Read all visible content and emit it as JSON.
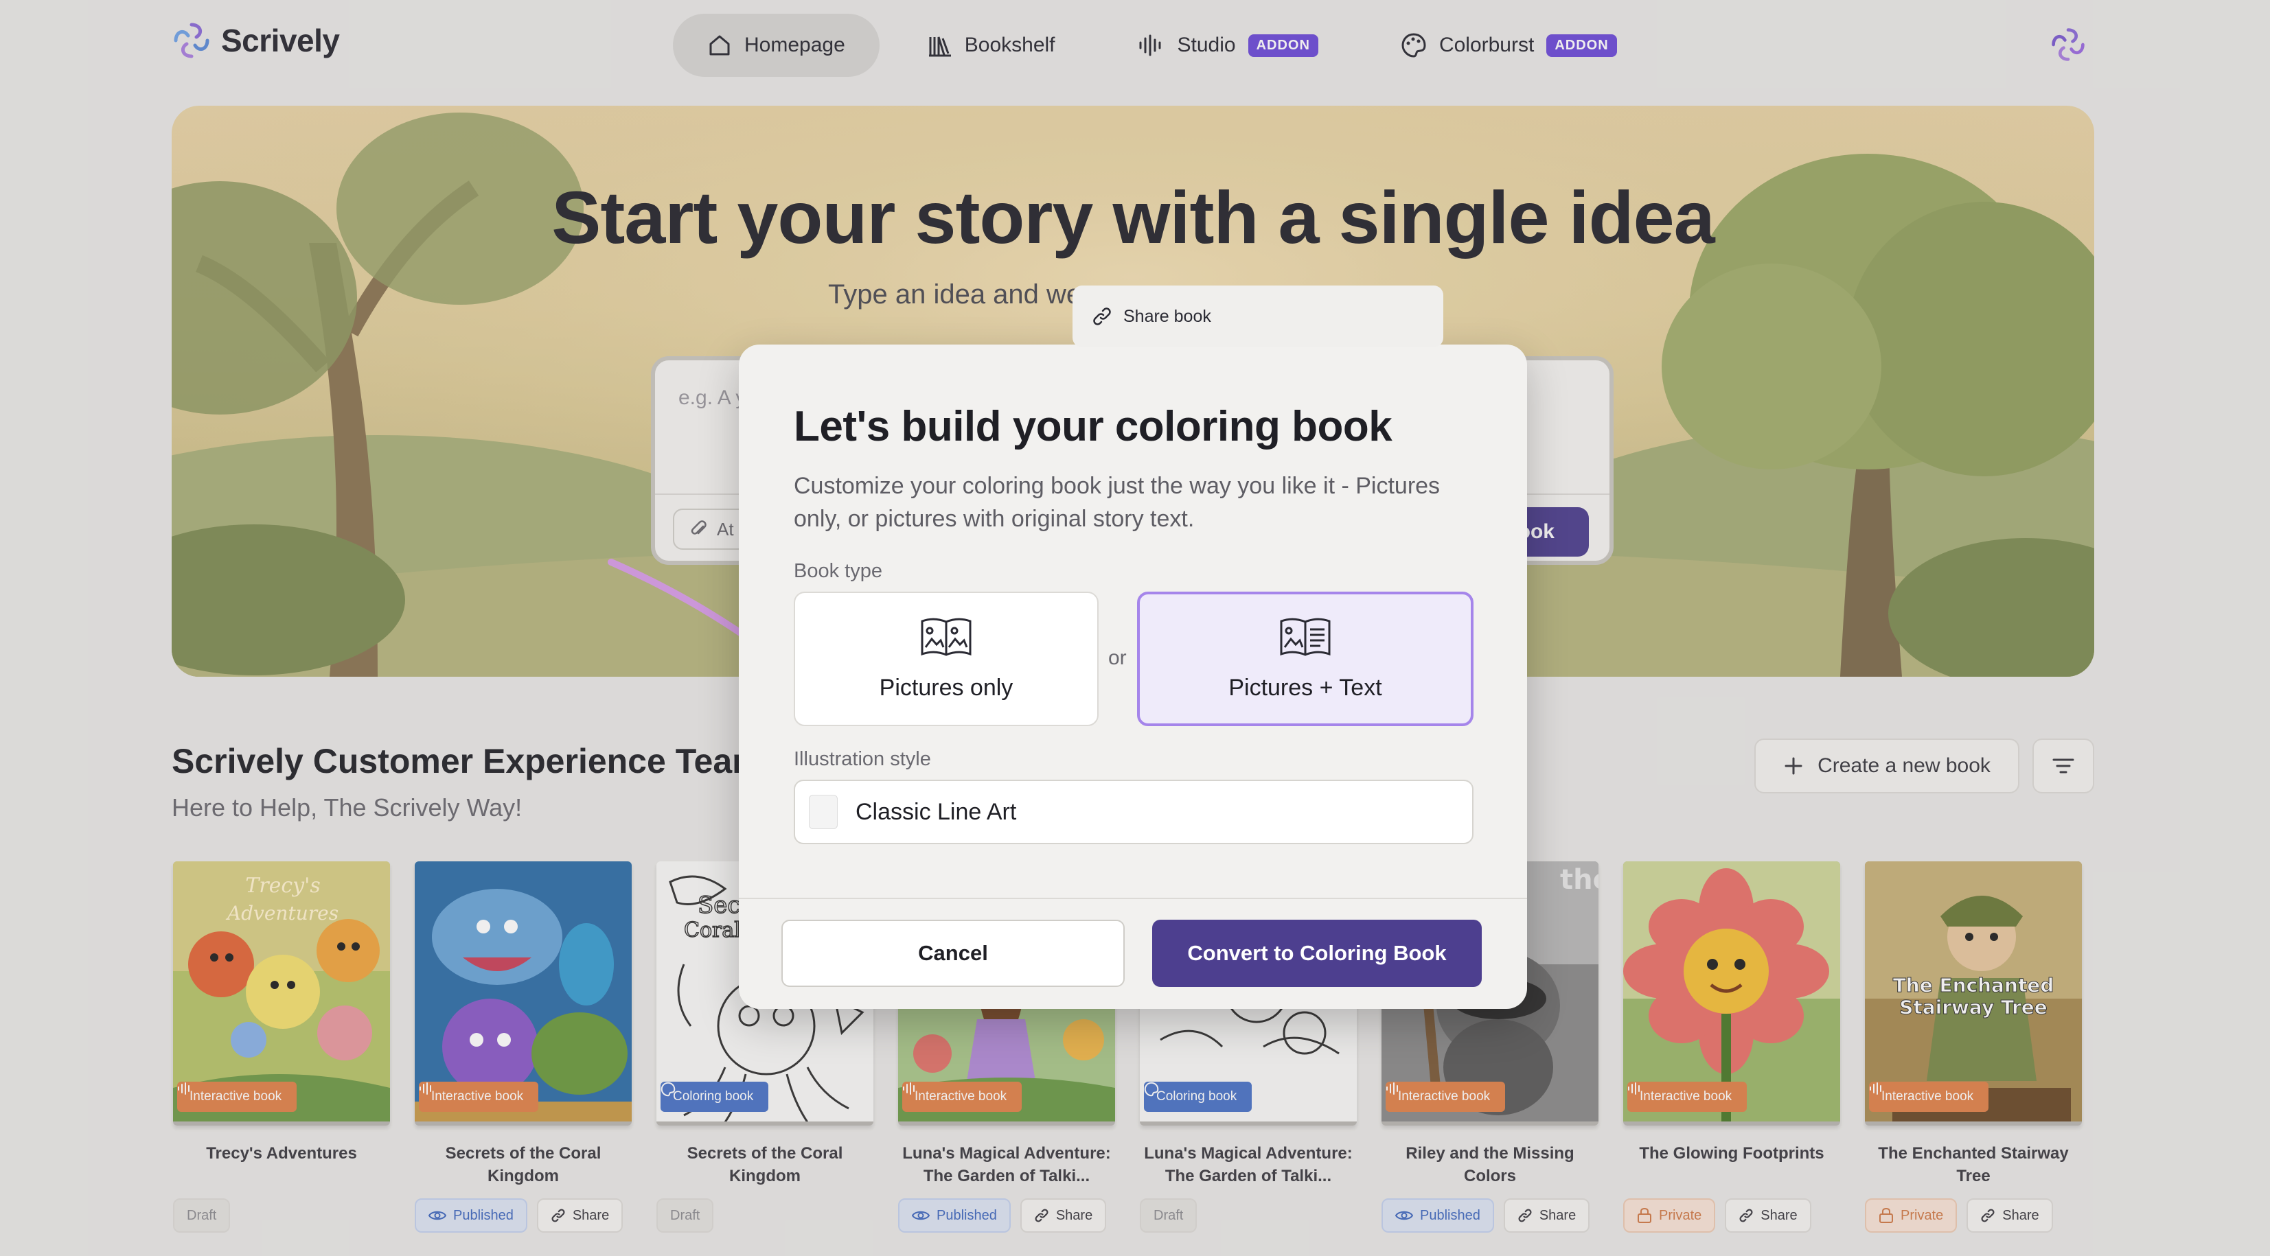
{
  "app": {
    "name": "Scrively"
  },
  "nav": {
    "tabs": [
      {
        "label": "Homepage",
        "active": true
      },
      {
        "label": "Bookshelf"
      },
      {
        "label": "Studio",
        "badge": "ADDON"
      },
      {
        "label": "Colorburst",
        "badge": "ADDON"
      }
    ]
  },
  "hero": {
    "title": "Start your story with a single idea",
    "subtitle": "Type an idea and we",
    "input_placeholder": "e.g. A y",
    "attach_label": "At",
    "create_label": "ook"
  },
  "share_popover": {
    "label": "Share book"
  },
  "team": {
    "title": "Scrively Customer Experience Team",
    "subtitle": "Here to Help, The Scrively Way!",
    "create_new_label": "Create a new book"
  },
  "books": [
    {
      "title": "Trecy's Adventures",
      "type": "Interactive book",
      "status": "Draft",
      "share": ""
    },
    {
      "title": "Secrets of the Coral Kingdom",
      "type": "Interactive book",
      "status": "Published",
      "share": "Share"
    },
    {
      "title": "Secrets of the Coral Kingdom",
      "type": "Coloring book",
      "status": "Draft",
      "share": ""
    },
    {
      "title": "Luna's Magical Adventure: The Garden of Talki...",
      "type": "Interactive book",
      "status": "Published",
      "share": "Share"
    },
    {
      "title": "Luna's Magical Adventure: The Garden of Talki...",
      "type": "Coloring book",
      "status": "Draft",
      "share": ""
    },
    {
      "title": "Riley and the Missing Colors",
      "type": "Interactive book",
      "status": "Published",
      "share": "Share"
    },
    {
      "title": "The Glowing Footprints",
      "type": "Interactive book",
      "status": "Private",
      "share": "Share"
    },
    {
      "title": "The Enchanted Stairway Tree",
      "type": "Interactive book",
      "status": "Private",
      "share": "Share"
    }
  ],
  "modal": {
    "title": "Let's build your coloring book",
    "description": "Customize your coloring book just the way you like it - Pictures only, or pictures with original story text.",
    "book_type_label": "Book type",
    "option_pictures_only": "Pictures only",
    "option_or": "or",
    "option_pictures_text": "Pictures + Text",
    "selected_option": "Pictures + Text",
    "illustration_style_label": "Illustration style",
    "illustration_style_value": "Classic Line Art",
    "cancel_label": "Cancel",
    "convert_label": "Convert to Coloring Book"
  },
  "colors": {
    "brand_purple": "#4d3f8f",
    "accent_violet": "#a585ea",
    "addon_badge": "#6b4bd8",
    "interactive_badge": "#e0824a",
    "coloring_badge": "#4a73c6"
  }
}
